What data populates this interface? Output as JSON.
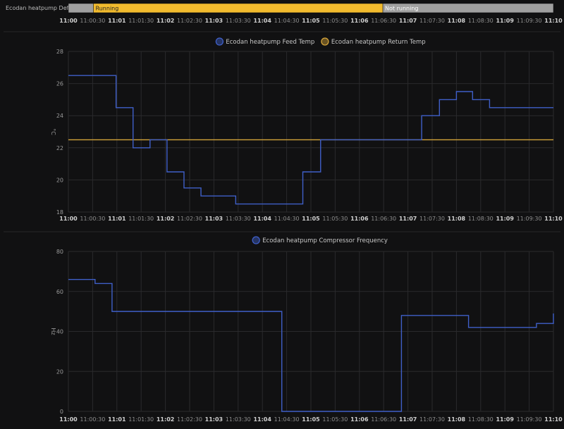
{
  "state_timeline": {
    "label": "Ecodan heatpump Defrost",
    "segments": [
      {
        "start": "11:00:00",
        "end": "11:00:31",
        "label": "",
        "color": "#a0a0a0"
      },
      {
        "start": "11:00:31",
        "end": "11:06:29",
        "label": "Running",
        "color": "#f2bb2e"
      },
      {
        "start": "11:06:29",
        "end": "11:10:00",
        "label": "Not running",
        "color": "#a0a0a0"
      }
    ]
  },
  "x_ticks": [
    "11:00",
    "11:00:30",
    "11:01",
    "11:01:30",
    "11:02",
    "11:02:30",
    "11:03",
    "11:03:30",
    "11:04",
    "11:04:30",
    "11:05",
    "11:05:30",
    "11:06",
    "11:06:30",
    "11:07",
    "11:07:30",
    "11:08",
    "11:08:30",
    "11:09",
    "11:09:30",
    "11:10"
  ],
  "chart_data": [
    {
      "type": "line",
      "step": true,
      "ylabel": "°C",
      "ylim": [
        18,
        28
      ],
      "yticks": [
        18,
        20,
        22,
        24,
        26,
        28
      ],
      "xlim": [
        "11:00:00",
        "11:10:00"
      ],
      "grid": true,
      "legend": "top-center",
      "series": [
        {
          "name": "Ecodan heatpump Feed Temp",
          "color": "#3f5fc8",
          "x": [
            "11:00:00",
            "11:00:59",
            "11:01:20",
            "11:01:41",
            "11:02:02",
            "11:02:23",
            "11:02:44",
            "11:03:27",
            "11:04:50",
            "11:05:12",
            "11:07:17",
            "11:07:39",
            "11:08:00",
            "11:08:20",
            "11:08:41"
          ],
          "values": [
            26.5,
            24.5,
            22,
            22.5,
            20.5,
            19.5,
            19,
            18.5,
            20.5,
            22.5,
            24,
            25,
            25.5,
            25,
            24.5
          ]
        },
        {
          "name": "Ecodan heatpump Return Temp",
          "color": "#d4a43a",
          "x": [
            "11:00:00"
          ],
          "values": [
            22.5
          ]
        }
      ]
    },
    {
      "type": "line",
      "step": true,
      "ylabel": "Hz",
      "ylim": [
        0,
        80
      ],
      "yticks": [
        0,
        20,
        40,
        60,
        80
      ],
      "xlim": [
        "11:00:00",
        "11:10:00"
      ],
      "grid": true,
      "legend": "top-center",
      "series": [
        {
          "name": "Ecodan heatpump Compressor Frequency",
          "color": "#3f5fc8",
          "x": [
            "11:00:00",
            "11:00:33",
            "11:00:54",
            "11:04:24",
            "11:06:52",
            "11:08:15",
            "11:09:39",
            "11:10:00"
          ],
          "values": [
            66,
            64,
            50,
            0,
            48,
            42,
            44,
            49
          ]
        }
      ]
    }
  ]
}
